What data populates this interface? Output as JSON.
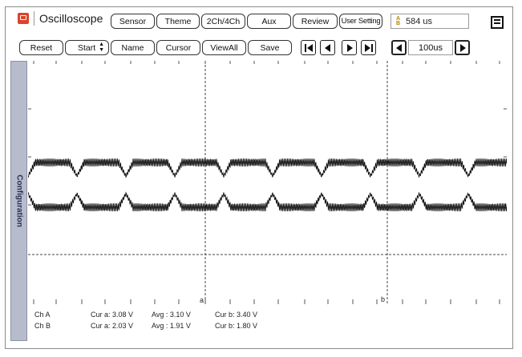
{
  "header": {
    "title": "Oscilloscope",
    "tabs": [
      "Sensor",
      "Theme",
      "2Ch/4Ch",
      "Aux",
      "Review",
      "User Setting"
    ],
    "readout_icon": "ab-icon",
    "readout": "584 us"
  },
  "toolbar": {
    "reset": "Reset",
    "start": "Start",
    "name": "Name",
    "cursor": "Cursor",
    "viewall": "ViewAll",
    "save": "Save",
    "timebase": "100us"
  },
  "sidebar": {
    "label": "Configuration"
  },
  "plot": {
    "cursor_a_label": "a",
    "cursor_b_label": "b",
    "trace_color": "#111111",
    "grid_color": "#444444"
  },
  "channels": [
    {
      "name": "Ch A",
      "cur_a": "Cur a: 3.08 V",
      "avg": "Avg : 3.10 V",
      "cur_b": "Cur b: 3.40 V"
    },
    {
      "name": "Ch B",
      "cur_a": "Cur a: 2.03 V",
      "avg": "Avg : 1.91 V",
      "cur_b": "Cur b: 1.80 V"
    }
  ]
}
